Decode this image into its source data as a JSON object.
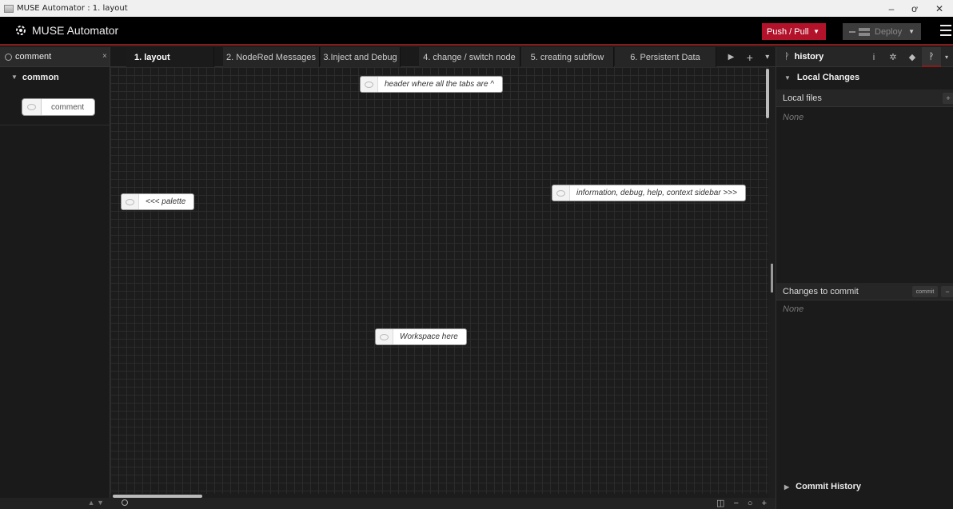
{
  "window": {
    "title": "MUSE Automator : 1. layout",
    "minimize_icon": "–",
    "restore_icon": "ơ",
    "close_icon": "✕"
  },
  "header": {
    "app_name": "MUSE Automator",
    "push_label": "Push / Pull",
    "deploy_label": "Deploy",
    "accent_color": "#b3122b"
  },
  "palette": {
    "search_value": "comment",
    "clear_icon": "×",
    "category": "common",
    "nodes": [
      {
        "label": "comment"
      }
    ]
  },
  "tabs": [
    {
      "label": "1. layout",
      "active": true
    },
    {
      "label": "2. NodeRed Messages"
    },
    {
      "label": "3.Inject and Debug"
    },
    {
      "label": "4. change / switch node"
    },
    {
      "label": "5. creating subflow"
    },
    {
      "label": "6. Persistent Data"
    }
  ],
  "tab_tools": {
    "scroll_icon": "▶",
    "add_icon": "+",
    "list_icon": "▾"
  },
  "workspace": {
    "comments": [
      {
        "text": "header where all the tabs are ^"
      },
      {
        "text": "<<< palette"
      },
      {
        "text": "information, debug, help, context sidebar >>>"
      },
      {
        "text": "Workspace here"
      }
    ]
  },
  "ws_footer": {
    "zoom": "◫ − ○ +"
  },
  "sidebar": {
    "active_tab": "history",
    "tab_icons": [
      "i",
      "✲",
      "◆",
      "ᚹ"
    ],
    "local_changes": "Local Changes",
    "local_files": "Local files",
    "local_files_none": "None",
    "changes_to_commit": "Changes to commit",
    "commit_button": "commit",
    "changes_none": "None",
    "commit_history": "Commit History"
  }
}
